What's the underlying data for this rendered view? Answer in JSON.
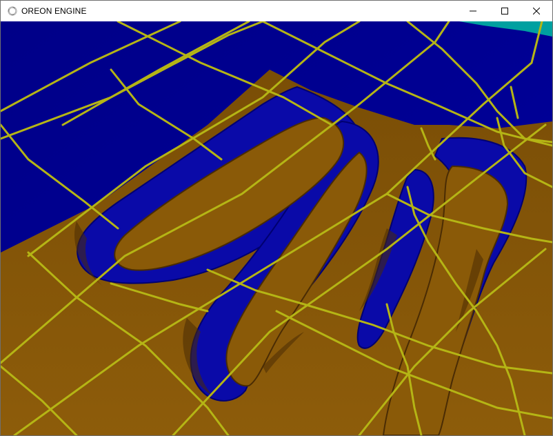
{
  "window": {
    "title": "OREON ENGINE",
    "app_icon": "engine-ring-icon",
    "controls": [
      "minimize-icon",
      "maximize-icon",
      "close-icon"
    ]
  },
  "scene": {
    "description_icon": "3d-terrain-viewport",
    "colors": {
      "ground": "#8a5a08",
      "ground_shadow": "#4a2c04",
      "water": "#00009a",
      "water_light": "#1a1ad0",
      "grid_lines": "#b5b515",
      "shore_accent": "#00a0a0"
    }
  }
}
